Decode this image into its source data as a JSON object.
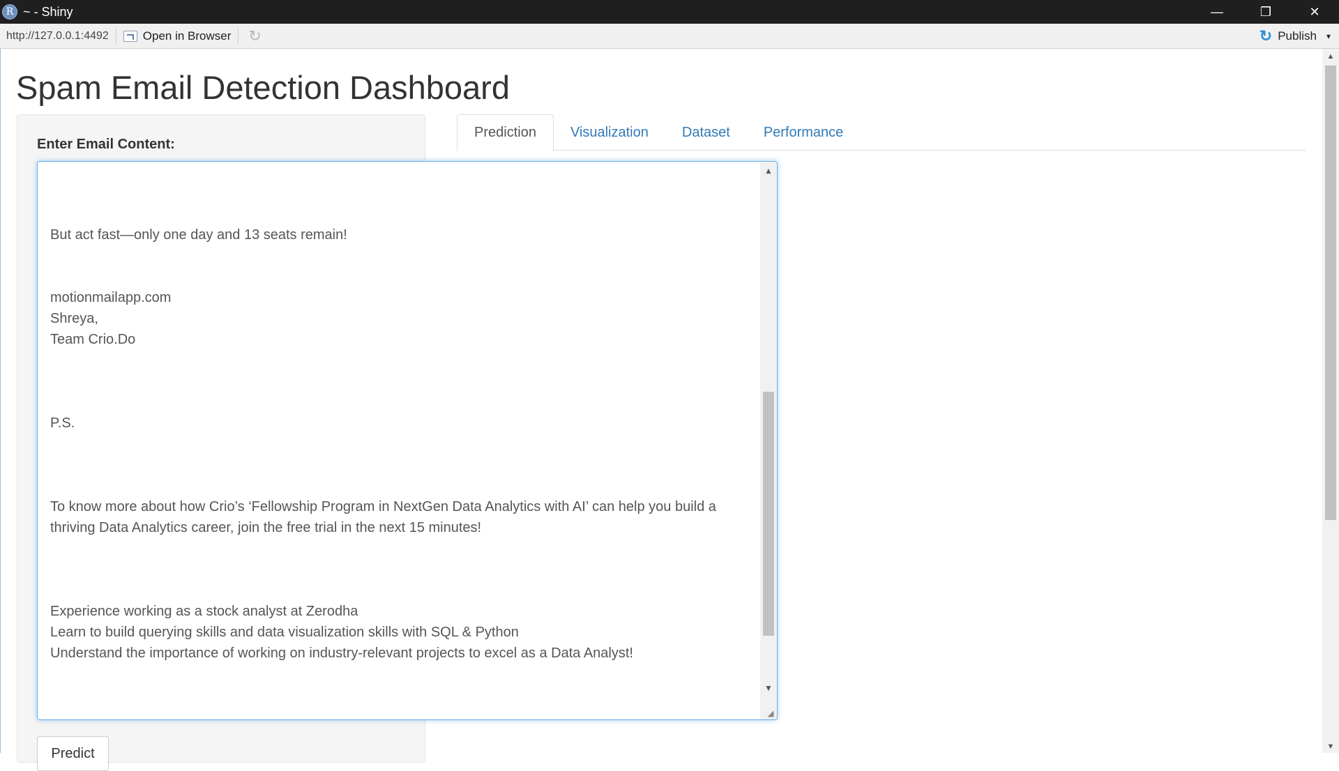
{
  "window": {
    "title": "~ - Shiny",
    "logo_letter": "R",
    "minimize_glyph": "—",
    "restore_glyph": "❐",
    "close_glyph": "✕"
  },
  "toolbar": {
    "url": "http://127.0.0.1:4492",
    "open_in_browser_label": "Open in Browser",
    "refresh_glyph": "↻",
    "publish_glyph": "↻",
    "publish_label": "Publish",
    "publish_caret": "▾"
  },
  "app": {
    "title": "Spam Email Detection Dashboard",
    "input_label": "Enter Email Content:",
    "email_text": "\n\n\nBut act fast—only one day and 13 seats remain!\n\n\nmotionmailapp.com\nShreya,\nTeam Crio.Do\n\n\n\nP.S.\n\n\n\nTo know more about how Crio’s ‘Fellowship Program in NextGen Data Analytics with AI’ can help you build a thriving Data Analytics career, join the free trial in the next 15 minutes!\n\n\n\nExperience working as a stock analyst at Zerodha\nLearn to build querying skills and data visualization skills with SQL & Python\nUnderstand the importance of working on industry-relevant projects to excel as a Data Analyst!",
    "predict_label": "Predict",
    "tabs": [
      {
        "label": "Prediction",
        "active": true
      },
      {
        "label": "Visualization",
        "active": false
      },
      {
        "label": "Dataset",
        "active": false
      },
      {
        "label": "Performance",
        "active": false
      }
    ]
  },
  "colors": {
    "link": "#337ab7",
    "focus_border": "#66afe9",
    "titlebar": "#1f1f1f"
  }
}
